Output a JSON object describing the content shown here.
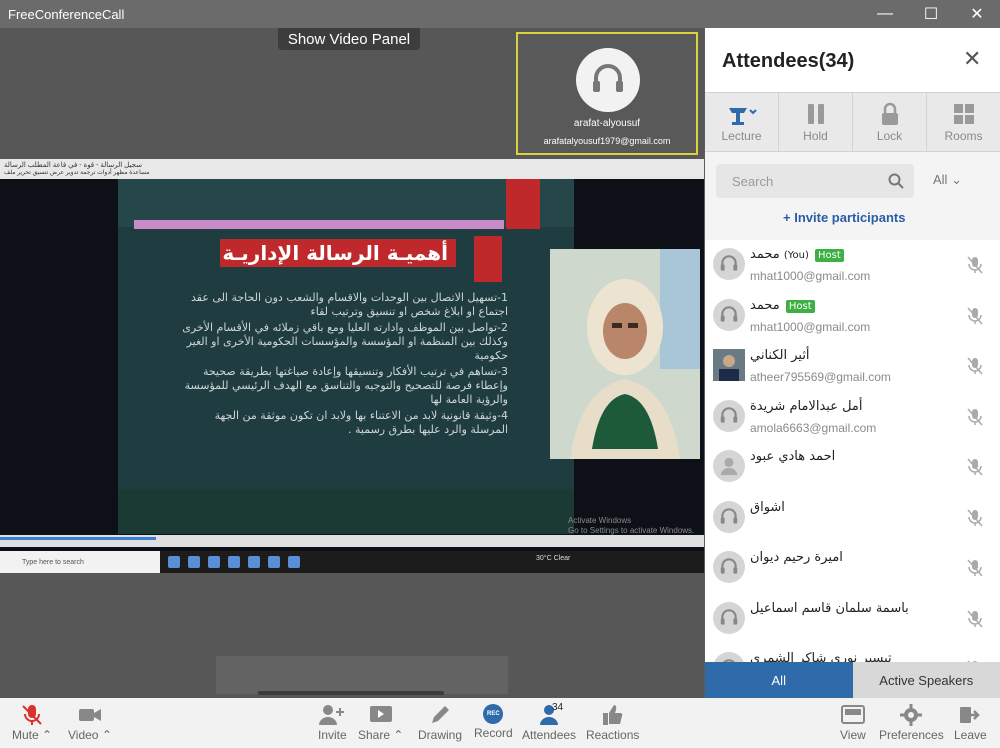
{
  "window": {
    "title": "FreeConferenceCall",
    "controls": [
      "—",
      "☐",
      "✕"
    ]
  },
  "stage": {
    "show_video_panel": "Show Video Panel",
    "active_speaker": {
      "name": "arafat-alyousuf",
      "email": "arafatalyousuf1979@gmail.com"
    },
    "shared_screen": {
      "app_title": "سجيل الرسالة - قوة - في قاعة المطلب الرسالة",
      "menu": "مساعدة  مظهر  أدوات  ترجمة  تدوير  عرض  تنسيق  تحرير  ملف",
      "slide_title": "أهميـة الرسالة الإداريـة",
      "slide_points": [
        "1-تسهيل الاتصال بين الوحدات والاقسام والشعب دون الحاجة الى عقد اجتماع او ابلاغ شخص او تنسيق وترتيب لقاء",
        "2-تواصل بين الموظف وادارته العليا ومع باقي زملائه في الأقسام الأخرى وكذلك بين المنظمة او المؤسسة والمؤسسات الحكومية الأخرى او الغير حكومية",
        "3-تساهم في ترتيب الأفكار وتنسيقها وإعادة صياغتها بطريقة صحيحة وإعطاء فرصة للتصحيح والتوجيه والتناسق مع الهدف الرئيسي للمؤسسة والرؤية العامة لها",
        "4-وثيقة قانونية لابد من الاعتناء بها ولابد ان تكون موثقة من الجهة المرسلة والرد عليها بطرق رسمية ."
      ],
      "watermark_line1": "Activate Windows",
      "watermark_line2": "Go to Settings to activate Windows.",
      "taskbar_search": "Type here to search",
      "weather": "30°C  Clear"
    }
  },
  "panel": {
    "title": "Attendees(34)",
    "tools": [
      {
        "label": "Lecture",
        "icon": "lecture-icon"
      },
      {
        "label": "Hold",
        "icon": "pause-icon"
      },
      {
        "label": "Lock",
        "icon": "lock-icon"
      },
      {
        "label": "Rooms",
        "icon": "grid-icon"
      }
    ],
    "search_placeholder": "Search",
    "filter": "All",
    "invite": "Invite participants",
    "attendees": [
      {
        "name": "محمد",
        "you": "(You)",
        "host": "Host",
        "email": "mhat1000@gmail.com"
      },
      {
        "name": "محمد",
        "you": "",
        "host": "Host",
        "email": "mhat1000@gmail.com"
      },
      {
        "name": "أثير الكناني",
        "you": "",
        "host": "",
        "email": "atheer795569@gmail.com"
      },
      {
        "name": "أمل عبدالامام شريدة",
        "you": "",
        "host": "",
        "email": "amola6663@gmail.com"
      },
      {
        "name": "احمد هادي عبود",
        "you": "",
        "host": "",
        "email": ""
      },
      {
        "name": "اشواق",
        "you": "",
        "host": "",
        "email": ""
      },
      {
        "name": "اميرة رحيم ديوان",
        "you": "",
        "host": "",
        "email": ""
      },
      {
        "name": "باسمة سلمان قاسم اسماعيل",
        "you": "",
        "host": "",
        "email": ""
      },
      {
        "name": "تيسير نوري شاكر الشمري",
        "you": "",
        "host": "",
        "email": ""
      }
    ],
    "tabs": {
      "all": "All",
      "active_speakers": "Active Speakers"
    }
  },
  "toolbar": {
    "mute": "Mute",
    "video": "Video",
    "invite": "Invite",
    "share": "Share",
    "drawing": "Drawing",
    "record": "Record",
    "record_badge": "REC",
    "attendees": "Attendees",
    "attendees_count": "34",
    "reactions": "Reactions",
    "view": "View",
    "preferences": "Preferences",
    "leave": "Leave"
  },
  "colors": {
    "accent": "#2f6aab",
    "host_badge": "#3cb043",
    "speaker_border": "#d9d23a",
    "mute_red": "#d9342b"
  }
}
